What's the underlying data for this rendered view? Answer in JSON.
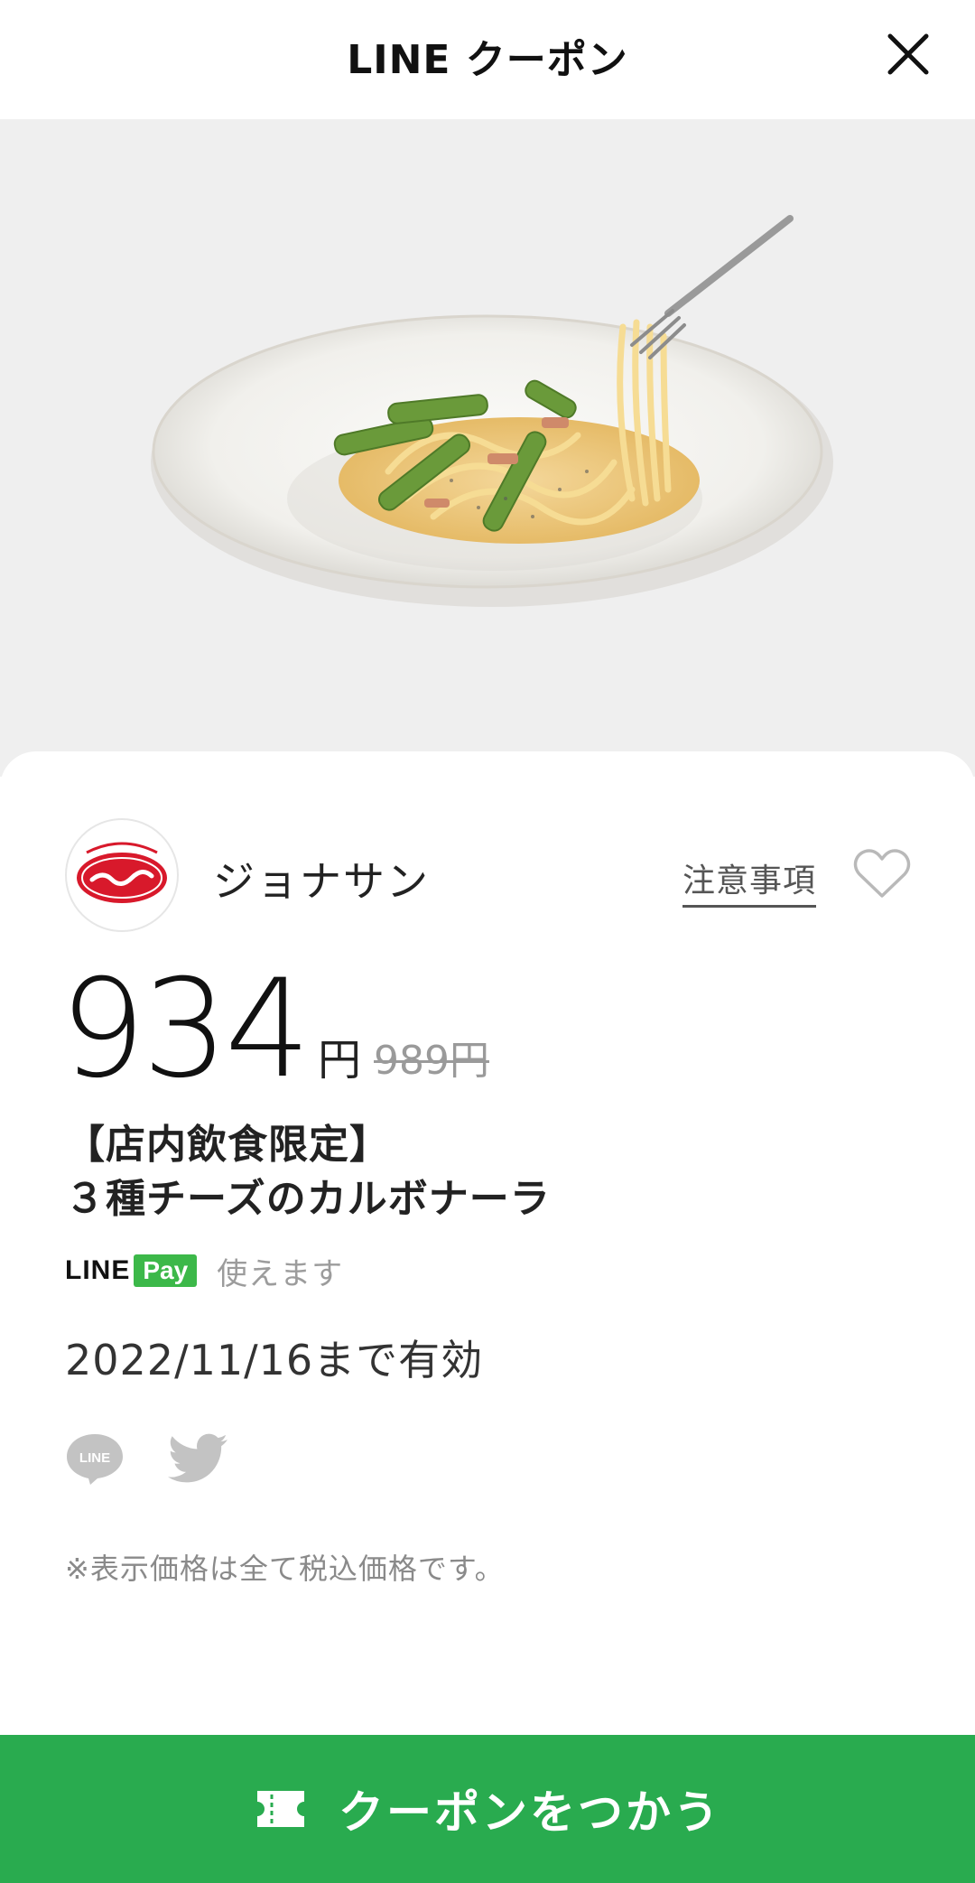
{
  "header": {
    "title": "LINE クーポン"
  },
  "hero": {
    "image": "carbonara-pasta-plate"
  },
  "brand": {
    "name": "ジョナサン",
    "notes_label": "注意事項"
  },
  "price": {
    "current": "934",
    "unit": "円",
    "original": "989円"
  },
  "coupon": {
    "title_line1": "【店内飲食限定】",
    "title_line2": "３種チーズのカルボナーラ"
  },
  "linepay": {
    "line": "LINE",
    "pay": "Pay",
    "usable": "使えます"
  },
  "validity": "2022/11/16まで有効",
  "share": {
    "line_icon": "line-share-icon",
    "twitter_icon": "twitter-share-icon"
  },
  "note": "※表示価格は全て税込価格です。",
  "action": {
    "use_label": "クーポンをつかう"
  },
  "colors": {
    "accent": "#29ab4f",
    "pay_green": "#3cb849"
  }
}
